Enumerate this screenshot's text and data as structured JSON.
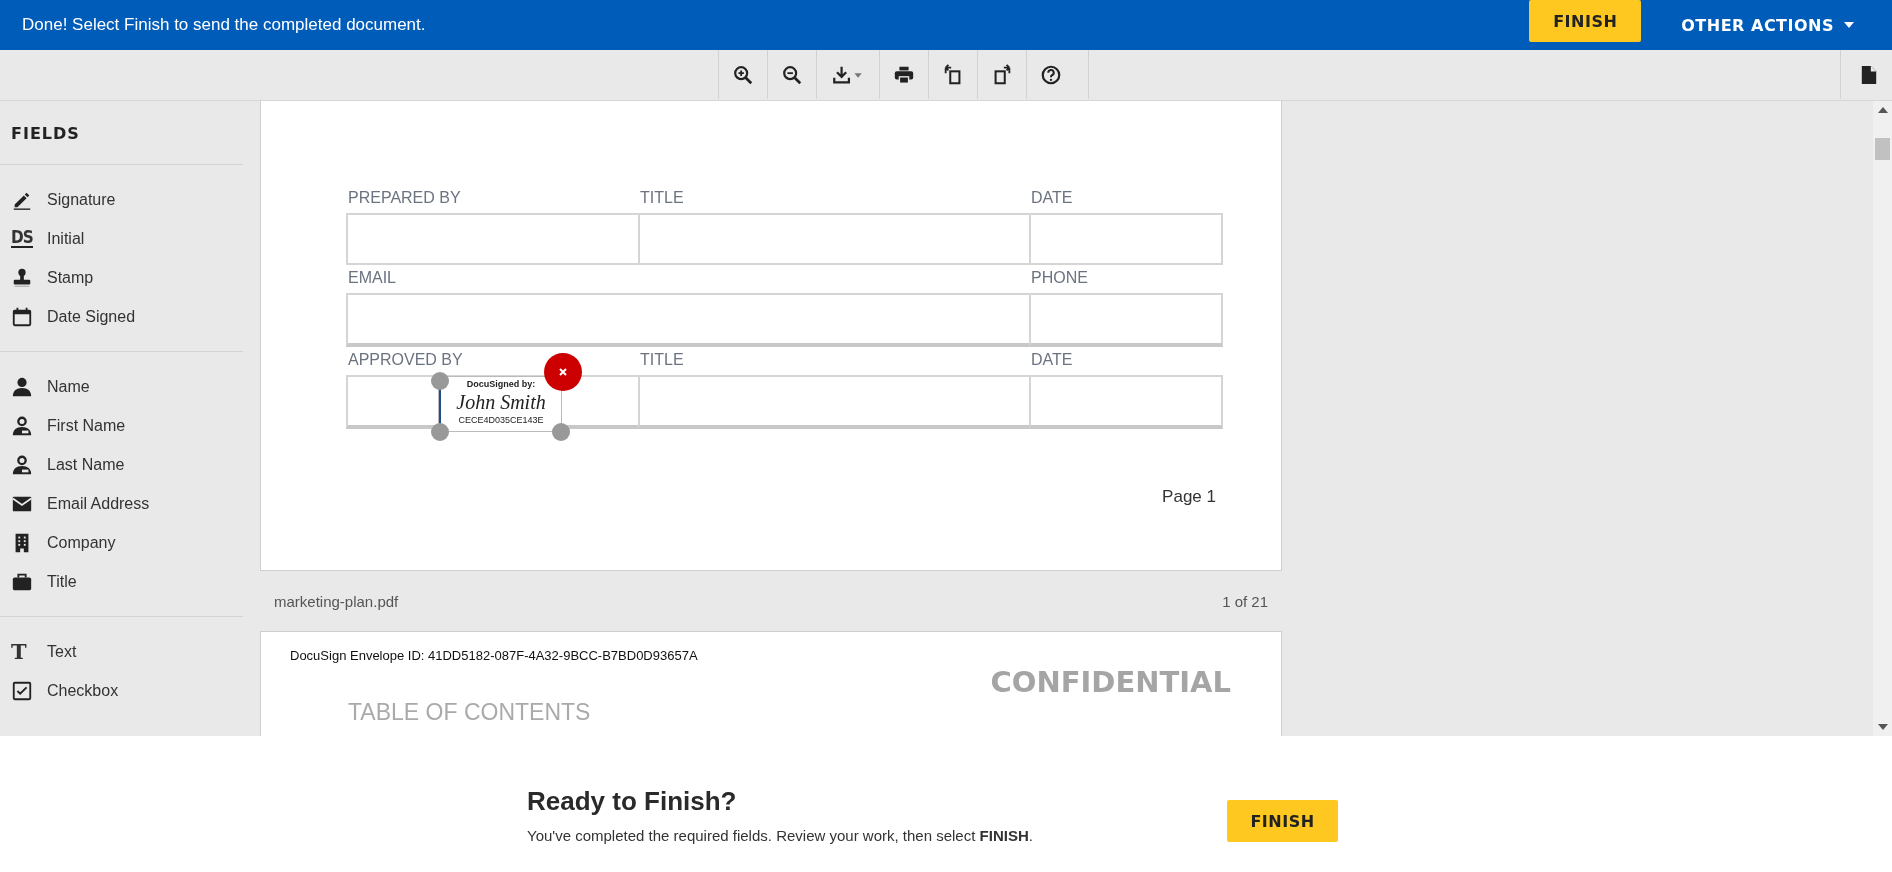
{
  "banner": {
    "message": "Done! Select Finish to send the completed document.",
    "finish_button": "FINISH",
    "other_actions": "OTHER ACTIONS"
  },
  "sidebar": {
    "title": "FIELDS",
    "groups": [
      {
        "items": [
          {
            "kind": "signature",
            "label": "Signature"
          },
          {
            "kind": "initial",
            "label": "Initial",
            "icon_text": "DS"
          },
          {
            "kind": "stamp",
            "label": "Stamp"
          },
          {
            "kind": "date",
            "label": "Date Signed"
          }
        ]
      },
      {
        "items": [
          {
            "kind": "person",
            "label": "Name"
          },
          {
            "kind": "person_badge",
            "label": "First Name"
          },
          {
            "kind": "person_badge",
            "label": "Last Name"
          },
          {
            "kind": "mail",
            "label": "Email Address"
          },
          {
            "kind": "building",
            "label": "Company"
          },
          {
            "kind": "briefcase",
            "label": "Title"
          }
        ]
      },
      {
        "items": [
          {
            "kind": "text",
            "label": "Text",
            "icon_text": "T"
          },
          {
            "kind": "checkbox",
            "label": "Checkbox"
          }
        ]
      }
    ]
  },
  "document": {
    "page1": {
      "rows": [
        {
          "fields": [
            {
              "label": "PREPARED BY",
              "wide": false
            },
            {
              "label": "TITLE",
              "wide": false
            },
            {
              "label": "DATE",
              "wide": false
            }
          ]
        },
        {
          "fields": [
            {
              "label": "EMAIL",
              "wide": true
            },
            {
              "label": "PHONE",
              "wide": false
            }
          ]
        },
        {
          "fields": [
            {
              "label": "APPROVED BY",
              "wide": false
            },
            {
              "label": "TITLE",
              "wide": false
            },
            {
              "label": "DATE",
              "wide": false
            }
          ]
        }
      ],
      "signature": {
        "header": "DocuSigned by:",
        "name": "John Smith",
        "id": "CECE4D035CE143E",
        "selected": true
      },
      "page_label": "Page 1"
    },
    "footer": {
      "filename": "marketing-plan.pdf",
      "page_count": "1 of 21"
    },
    "page2": {
      "envelope_id": "DocuSign Envelope ID: 41DD5182-087F-4A32-9BCC-B7BD0D93657A",
      "stamp": "CONFIDENTIAL",
      "heading": "TABLE OF CONTENTS"
    }
  },
  "finish_panel": {
    "title": "Ready to Finish?",
    "text": "You've completed the required fields. Review your work, then select **FINISH**.",
    "button": "FINISH"
  }
}
